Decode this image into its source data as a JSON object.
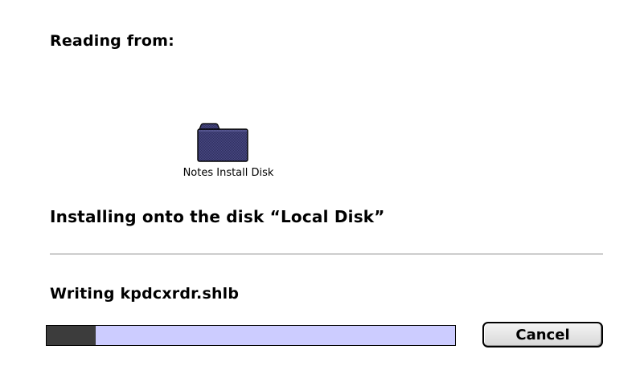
{
  "dialog": {
    "reading_from_label": "Reading from:",
    "source_disk": {
      "name": "Notes Install Disk",
      "icon": "folder-icon"
    },
    "installing_text": "Installing onto the disk “Local Disk”",
    "status_text": "Writing kpdcxrdr.shlb",
    "progress": {
      "fraction": 0.12
    },
    "cancel_label": "Cancel"
  },
  "colors": {
    "progress_track": "#ccccff",
    "progress_fill": "#3c3c3c",
    "folder_body": "#3a3a6e"
  }
}
